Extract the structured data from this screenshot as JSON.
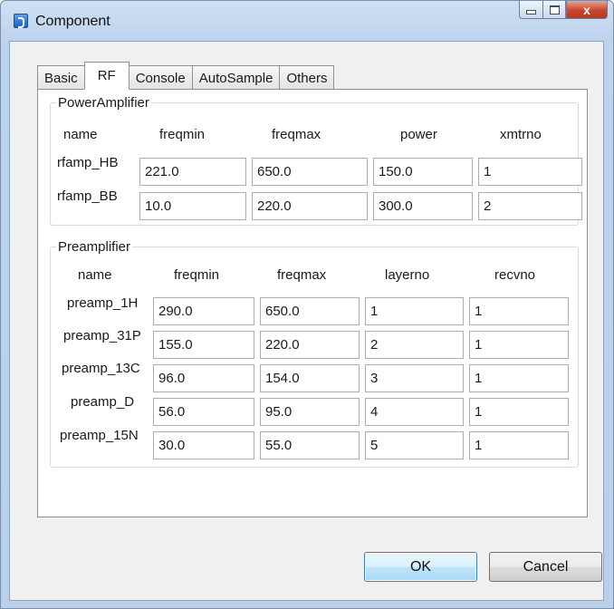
{
  "window": {
    "title": "Component",
    "close_glyph": "x"
  },
  "tabs": [
    {
      "label": "Basic"
    },
    {
      "label": "RF"
    },
    {
      "label": "Console"
    },
    {
      "label": "AutoSample"
    },
    {
      "label": "Others"
    }
  ],
  "power_amplifier": {
    "title": "PowerAmplifier",
    "headers": [
      "name",
      "freqmin",
      "freqmax",
      "power",
      "xmtrno"
    ],
    "rows": [
      {
        "name": "rfamp_HB",
        "values": [
          "221.0",
          "650.0",
          "150.0",
          "1"
        ]
      },
      {
        "name": "rfamp_BB",
        "values": [
          "10.0",
          "220.0",
          "300.0",
          "2"
        ]
      }
    ]
  },
  "preamplifier": {
    "title": "Preamplifier",
    "headers": [
      "name",
      "freqmin",
      "freqmax",
      "layerno",
      "recvno"
    ],
    "rows": [
      {
        "name": "preamp_1H",
        "values": [
          "290.0",
          "650.0",
          "1",
          "1"
        ]
      },
      {
        "name": "preamp_31P",
        "values": [
          "155.0",
          "220.0",
          "2",
          "1"
        ]
      },
      {
        "name": "preamp_13C",
        "values": [
          "96.0",
          "154.0",
          "3",
          "1"
        ]
      },
      {
        "name": "preamp_D",
        "values": [
          "56.0",
          "95.0",
          "4",
          "1"
        ]
      },
      {
        "name": "preamp_15N",
        "values": [
          "30.0",
          "55.0",
          "5",
          "1"
        ]
      }
    ]
  },
  "buttons": {
    "ok": "OK",
    "cancel": "Cancel"
  }
}
